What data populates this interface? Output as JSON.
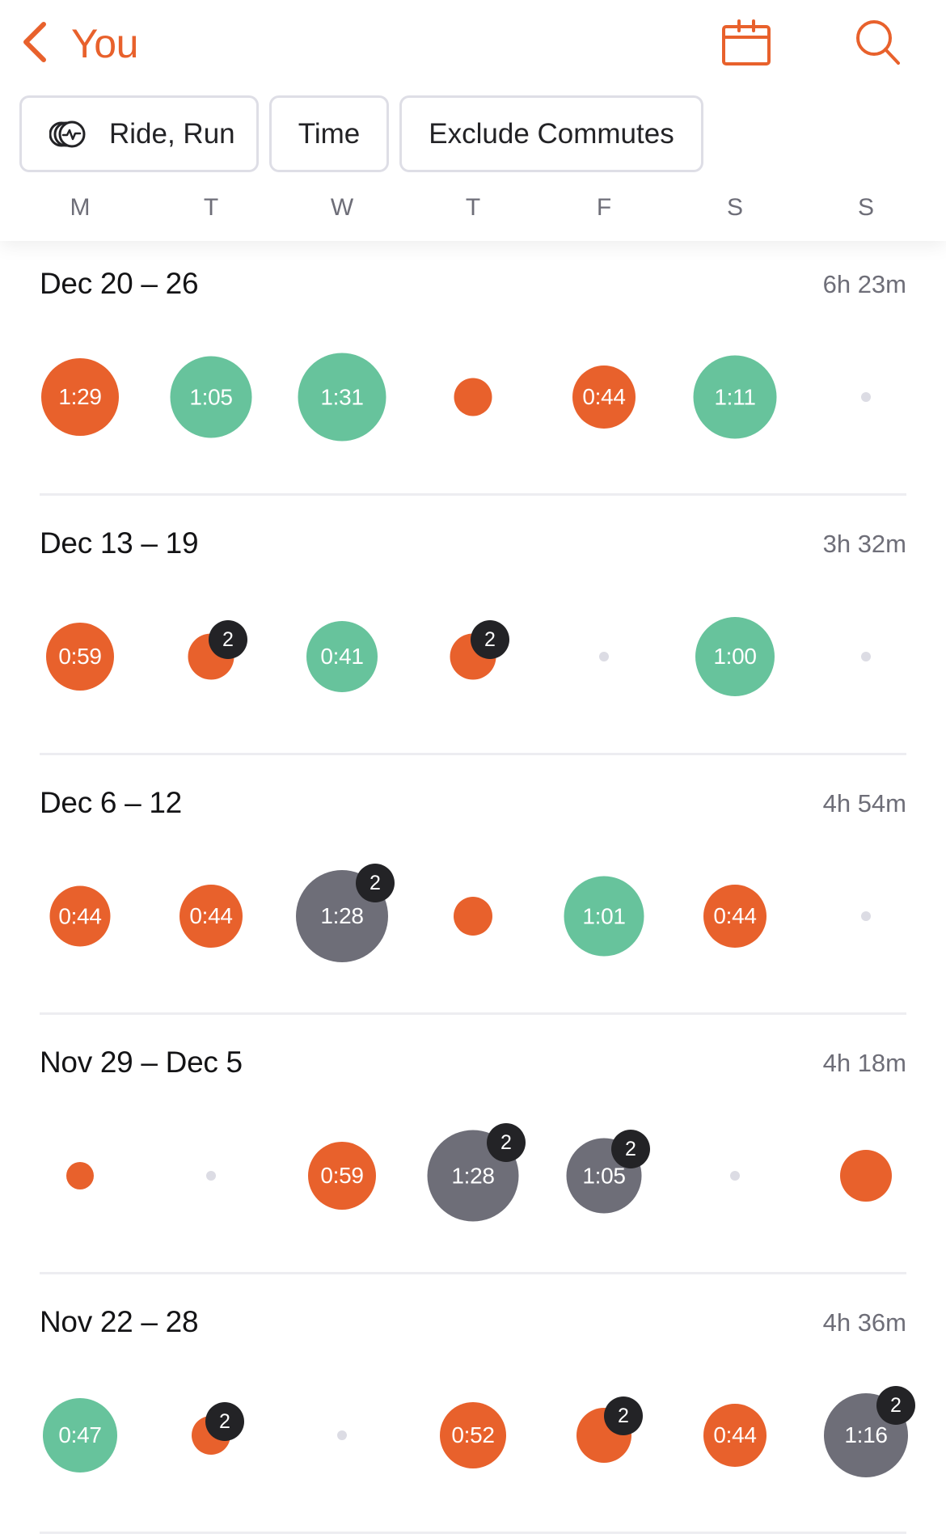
{
  "header": {
    "back_label": "You",
    "back_icon": "chevron-left-icon",
    "calendar_icon": "calendar-icon",
    "search_icon": "search-icon"
  },
  "filters": {
    "sport_label": "Ride, Run",
    "sport_icon": "multi-sport-icon",
    "metric_label": "Time",
    "commute_label": "Exclude Commutes"
  },
  "weekdays": [
    "M",
    "T",
    "W",
    "T",
    "F",
    "S",
    "S"
  ],
  "colors": {
    "accent": "#E8612C",
    "run": "#E8612C",
    "ride": "#67C39C",
    "multi": "#6E6E78",
    "badge": "#232326",
    "empty": "#DCDCE4"
  },
  "weeks": [
    {
      "title": "Dec 20 – 26",
      "total": "6h 23m",
      "days": [
        {
          "type": "run",
          "label": "1:29",
          "size": 0.84
        },
        {
          "type": "ride",
          "label": "1:05",
          "size": 0.89
        },
        {
          "type": "ride",
          "label": "1:31",
          "size": 0.96
        },
        {
          "type": "run",
          "label": "",
          "size": 0.41
        },
        {
          "type": "run",
          "label": "0:44",
          "size": 0.68
        },
        {
          "type": "ride",
          "label": "1:11",
          "size": 0.9
        },
        {
          "type": "empty",
          "label": "",
          "size": 0
        }
      ]
    },
    {
      "title": "Dec 13 – 19",
      "total": "3h 32m",
      "days": [
        {
          "type": "run",
          "label": "0:59",
          "size": 0.74
        },
        {
          "type": "run",
          "label": "",
          "size": 0.5,
          "count": "2"
        },
        {
          "type": "ride",
          "label": "0:41",
          "size": 0.77
        },
        {
          "type": "run",
          "label": "",
          "size": 0.5,
          "count": "2"
        },
        {
          "type": "empty",
          "label": "",
          "size": 0
        },
        {
          "type": "ride",
          "label": "1:00",
          "size": 0.86
        },
        {
          "type": "empty",
          "label": "",
          "size": 0
        }
      ]
    },
    {
      "title": "Dec 6 – 12",
      "total": "4h 54m",
      "days": [
        {
          "type": "run",
          "label": "0:44",
          "size": 0.66
        },
        {
          "type": "run",
          "label": "0:44",
          "size": 0.68
        },
        {
          "type": "multi",
          "label": "1:28",
          "size": 1.0,
          "count": "2"
        },
        {
          "type": "run",
          "label": "",
          "size": 0.42
        },
        {
          "type": "ride",
          "label": "1:01",
          "size": 0.87
        },
        {
          "type": "run",
          "label": "0:44",
          "size": 0.68
        },
        {
          "type": "empty",
          "label": "",
          "size": 0
        }
      ]
    },
    {
      "title": "Nov 29 – Dec 5",
      "total": "4h 18m",
      "days": [
        {
          "type": "run",
          "label": "",
          "size": 0.3
        },
        {
          "type": "empty",
          "label": "",
          "size": 0
        },
        {
          "type": "run",
          "label": "0:59",
          "size": 0.74
        },
        {
          "type": "multi",
          "label": "1:28",
          "size": 0.99,
          "count": "2"
        },
        {
          "type": "multi",
          "label": "1:05",
          "size": 0.82,
          "count": "2"
        },
        {
          "type": "empty",
          "label": "",
          "size": 0
        },
        {
          "type": "run",
          "label": "",
          "size": 0.56
        }
      ]
    },
    {
      "title": "Nov 22 – 28",
      "total": "4h 36m",
      "days": [
        {
          "type": "ride",
          "label": "0:47",
          "size": 0.81
        },
        {
          "type": "run",
          "label": "",
          "size": 0.42,
          "count": "2"
        },
        {
          "type": "empty",
          "label": "",
          "size": 0
        },
        {
          "type": "run",
          "label": "0:52",
          "size": 0.72
        },
        {
          "type": "run",
          "label": "",
          "size": 0.6,
          "count": "2"
        },
        {
          "type": "run",
          "label": "0:44",
          "size": 0.68
        },
        {
          "type": "multi",
          "label": "1:16",
          "size": 0.91,
          "count": "2"
        }
      ]
    }
  ]
}
